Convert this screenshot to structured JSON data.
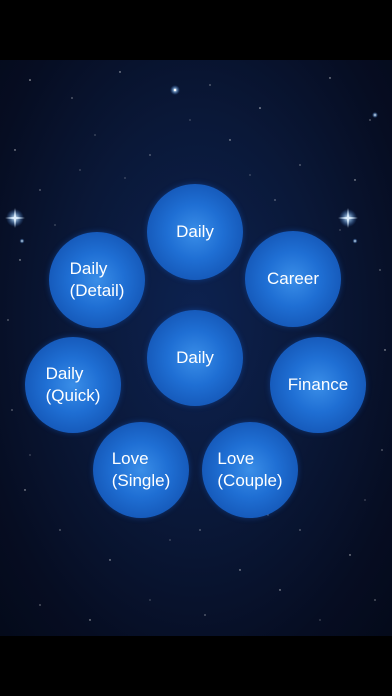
{
  "buttons": {
    "daily_top": "Daily",
    "career": "Career",
    "daily_detail": "Daily\n(Detail)",
    "daily_center": "Daily",
    "daily_quick": "Daily\n(Quick)",
    "finance": "Finance",
    "love_single": "Love\n(Single)",
    "love_couple": "Love\n(Couple)"
  },
  "colors": {
    "bubble": "#1f6fd4",
    "background": "#0a1838",
    "bars": "#000000"
  }
}
